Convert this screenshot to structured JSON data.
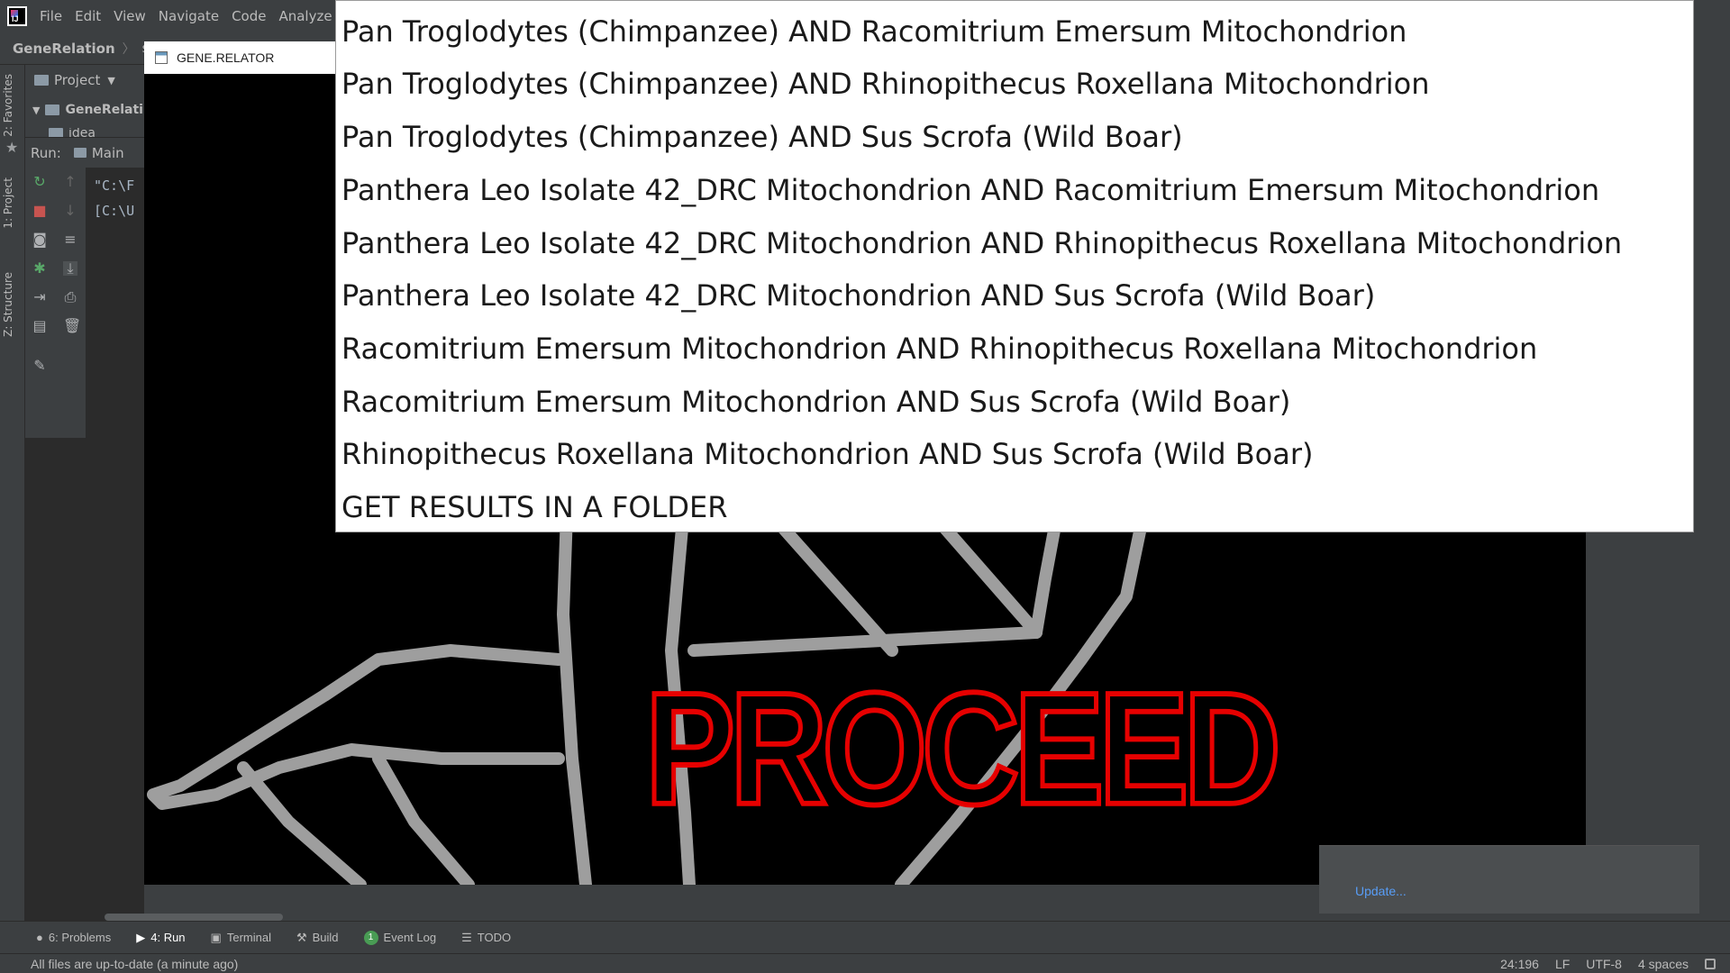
{
  "menubar": {
    "items": [
      "File",
      "Edit",
      "View",
      "Navigate",
      "Code",
      "Analyze"
    ]
  },
  "navbar": {
    "project": "GeneRelation",
    "src": "src"
  },
  "left_stripe": {
    "favorites": "2: Favorites",
    "project": "1: Project",
    "structure": "Z: Structure"
  },
  "project_panel": {
    "title": "Project",
    "root": "GeneRelati",
    "child": "idea"
  },
  "run_panel": {
    "label": "Run:",
    "config": "Main",
    "console": [
      "\"C:\\F",
      "[C:\\U"
    ]
  },
  "editor_tab": {
    "title": "GENE.RELATOR"
  },
  "app": {
    "proceed_label": "PROCEED"
  },
  "dropdown": {
    "options": [
      "Pan Troglodytes (Chimpanzee) AND Racomitrium Emersum Mitochondrion",
      "Pan Troglodytes (Chimpanzee) AND Rhinopithecus Roxellana Mitochondrion",
      "Pan Troglodytes (Chimpanzee) AND Sus Scrofa (Wild Boar)",
      "Panthera Leo Isolate 42_DRC Mitochondrion AND Racomitrium Emersum Mitochondrion",
      "Panthera Leo Isolate 42_DRC Mitochondrion AND Rhinopithecus Roxellana Mitochondrion",
      "Panthera Leo Isolate 42_DRC Mitochondrion AND Sus Scrofa (Wild Boar)",
      "Racomitrium Emersum Mitochondrion AND Rhinopithecus Roxellana Mitochondrion",
      "Racomitrium Emersum Mitochondrion AND Sus Scrofa (Wild Boar)",
      "Rhinopithecus Roxellana Mitochondrion AND Sus Scrofa (Wild Boar)",
      "GET RESULTS IN A FOLDER"
    ]
  },
  "update_panel": {
    "link": "Update..."
  },
  "bottom_tabs": {
    "problems": "6: Problems",
    "run": "4: Run",
    "terminal": "Terminal",
    "build": "Build",
    "event_log": "Event Log",
    "event_log_count": "1",
    "todo": "TODO"
  },
  "status": {
    "message": "All files are up-to-date (a minute ago)",
    "position": "24:196",
    "line_sep": "LF",
    "encoding": "UTF-8",
    "indent": "4 spaces"
  }
}
